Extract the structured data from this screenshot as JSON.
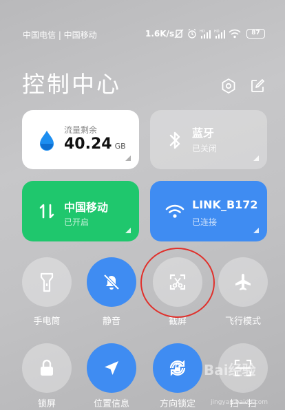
{
  "status_bar": {
    "carriers": "中国电信 | 中国移动",
    "network_speed": "1.6K/s",
    "battery": "87",
    "icons": [
      "vibrate-off-icon",
      "alarm-icon",
      "signal-hd-icon",
      "signal-hd-icon",
      "wifi-icon",
      "battery-icon"
    ]
  },
  "header": {
    "title": "控制中心",
    "icons": [
      "settings-icon",
      "edit-icon"
    ]
  },
  "tiles": {
    "data_usage": {
      "label": "流量剩余",
      "value": "40.24",
      "unit": "GB",
      "icon": "water-drop-icon"
    },
    "bluetooth": {
      "label": "蓝牙",
      "status": "已关闭",
      "icon": "bluetooth-icon"
    },
    "mobile_data": {
      "label": "中国移动",
      "status": "已开启",
      "icon": "data-arrows-icon"
    },
    "wifi": {
      "label": "LINK_B172",
      "status": "已连接",
      "icon": "wifi-icon"
    }
  },
  "toggles": [
    {
      "label": "手电筒",
      "state": "off",
      "icon": "flashlight-icon"
    },
    {
      "label": "静音",
      "state": "on",
      "icon": "bell-off-icon"
    },
    {
      "label": "截屏",
      "state": "off",
      "icon": "screenshot-scissors-icon"
    },
    {
      "label": "飞行模式",
      "state": "off",
      "icon": "airplane-icon"
    },
    {
      "label": "锁屏",
      "state": "off",
      "icon": "lock-icon"
    },
    {
      "label": "位置信息",
      "state": "on",
      "icon": "location-arrow-icon"
    },
    {
      "label": "方向锁定",
      "state": "on",
      "icon": "rotation-lock-icon"
    },
    {
      "label": "扫一扫",
      "state": "off",
      "icon": "scan-icon"
    }
  ],
  "colors": {
    "accent_blue": "#3f8cf2",
    "accent_green": "#1fc76d",
    "highlight_red": "#e0302b"
  },
  "watermark": {
    "brand": "Bai经验",
    "url": "jingyan.baidu.com"
  }
}
